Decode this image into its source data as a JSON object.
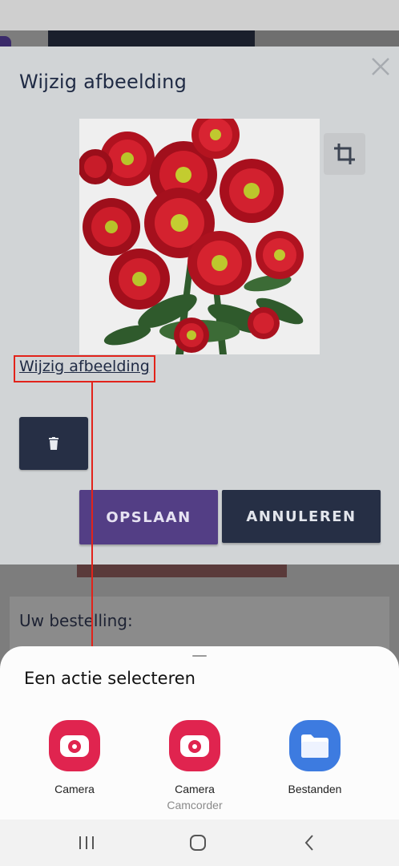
{
  "modal": {
    "title": "Wijzig afbeelding",
    "change_link": "Wijzig afbeelding",
    "save_label": "OPSLAAN",
    "cancel_label": "ANNULEREN"
  },
  "background": {
    "order_label": "Uw bestelling:"
  },
  "sheet": {
    "title": "Een actie selecteren",
    "apps": [
      {
        "label": "Camera",
        "sub": "",
        "icon": "camera-icon",
        "color": "#e0244f"
      },
      {
        "label": "Camera",
        "sub": "Camcorder",
        "icon": "camcorder-icon",
        "color": "#e0244f"
      },
      {
        "label": "Bestanden",
        "sub": "",
        "icon": "folder-icon",
        "color": "#3d7be0"
      }
    ]
  },
  "nav": {
    "icons": [
      "recents-icon",
      "home-icon",
      "back-icon"
    ]
  },
  "colors": {
    "primary_dark": "#262f45",
    "accent_purple": "#533e85",
    "annotation_red": "#e2231a"
  }
}
